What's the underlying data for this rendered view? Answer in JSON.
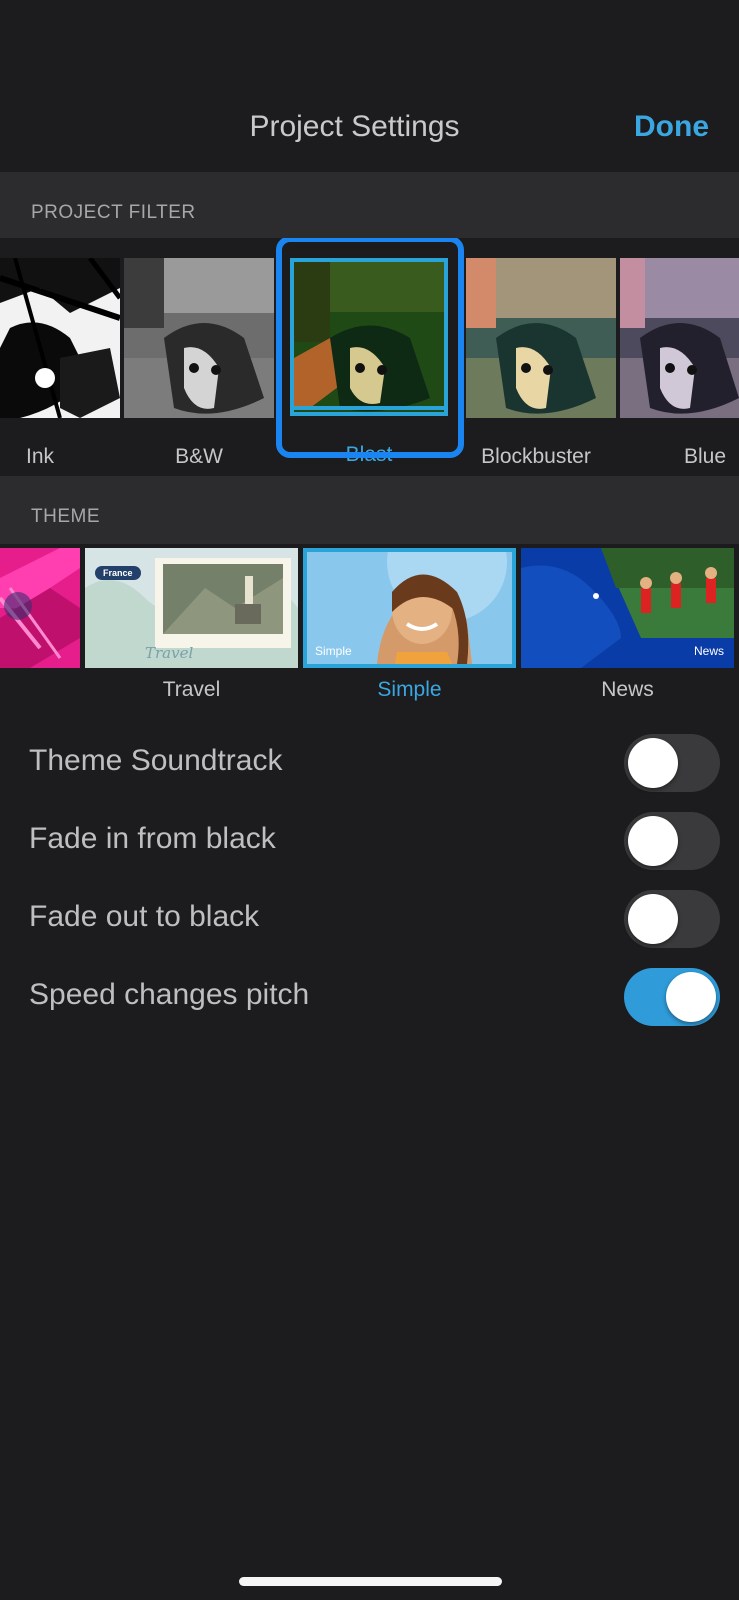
{
  "nav": {
    "title": "Project Settings",
    "done_label": "Done"
  },
  "project_filter": {
    "header": "PROJECT FILTER",
    "items": [
      {
        "label": "Ink",
        "selected": false
      },
      {
        "label": "B&W",
        "selected": false
      },
      {
        "label": "Blast",
        "selected": true
      },
      {
        "label": "Blockbuster",
        "selected": false
      },
      {
        "label": "Blue",
        "selected": false
      }
    ]
  },
  "theme": {
    "header": "THEME",
    "items": [
      {
        "label": "",
        "selected": false
      },
      {
        "label": "Travel",
        "selected": false,
        "overlay_text": "Travel",
        "badge": "France"
      },
      {
        "label": "Simple",
        "selected": true,
        "overlay_text": "Simple"
      },
      {
        "label": "News",
        "selected": false,
        "overlay_text": "News"
      }
    ]
  },
  "settings": [
    {
      "label": "Theme Soundtrack",
      "on": false
    },
    {
      "label": "Fade in from black",
      "on": false
    },
    {
      "label": "Fade out to black",
      "on": false
    },
    {
      "label": "Speed changes pitch",
      "on": true
    }
  ],
  "colors": {
    "accent": "#3aa7e0",
    "selection_frame": "#1a85f0",
    "toggle_on": "#2f9bd9",
    "background": "#1c1c1e",
    "section_header": "#2c2c2e"
  }
}
